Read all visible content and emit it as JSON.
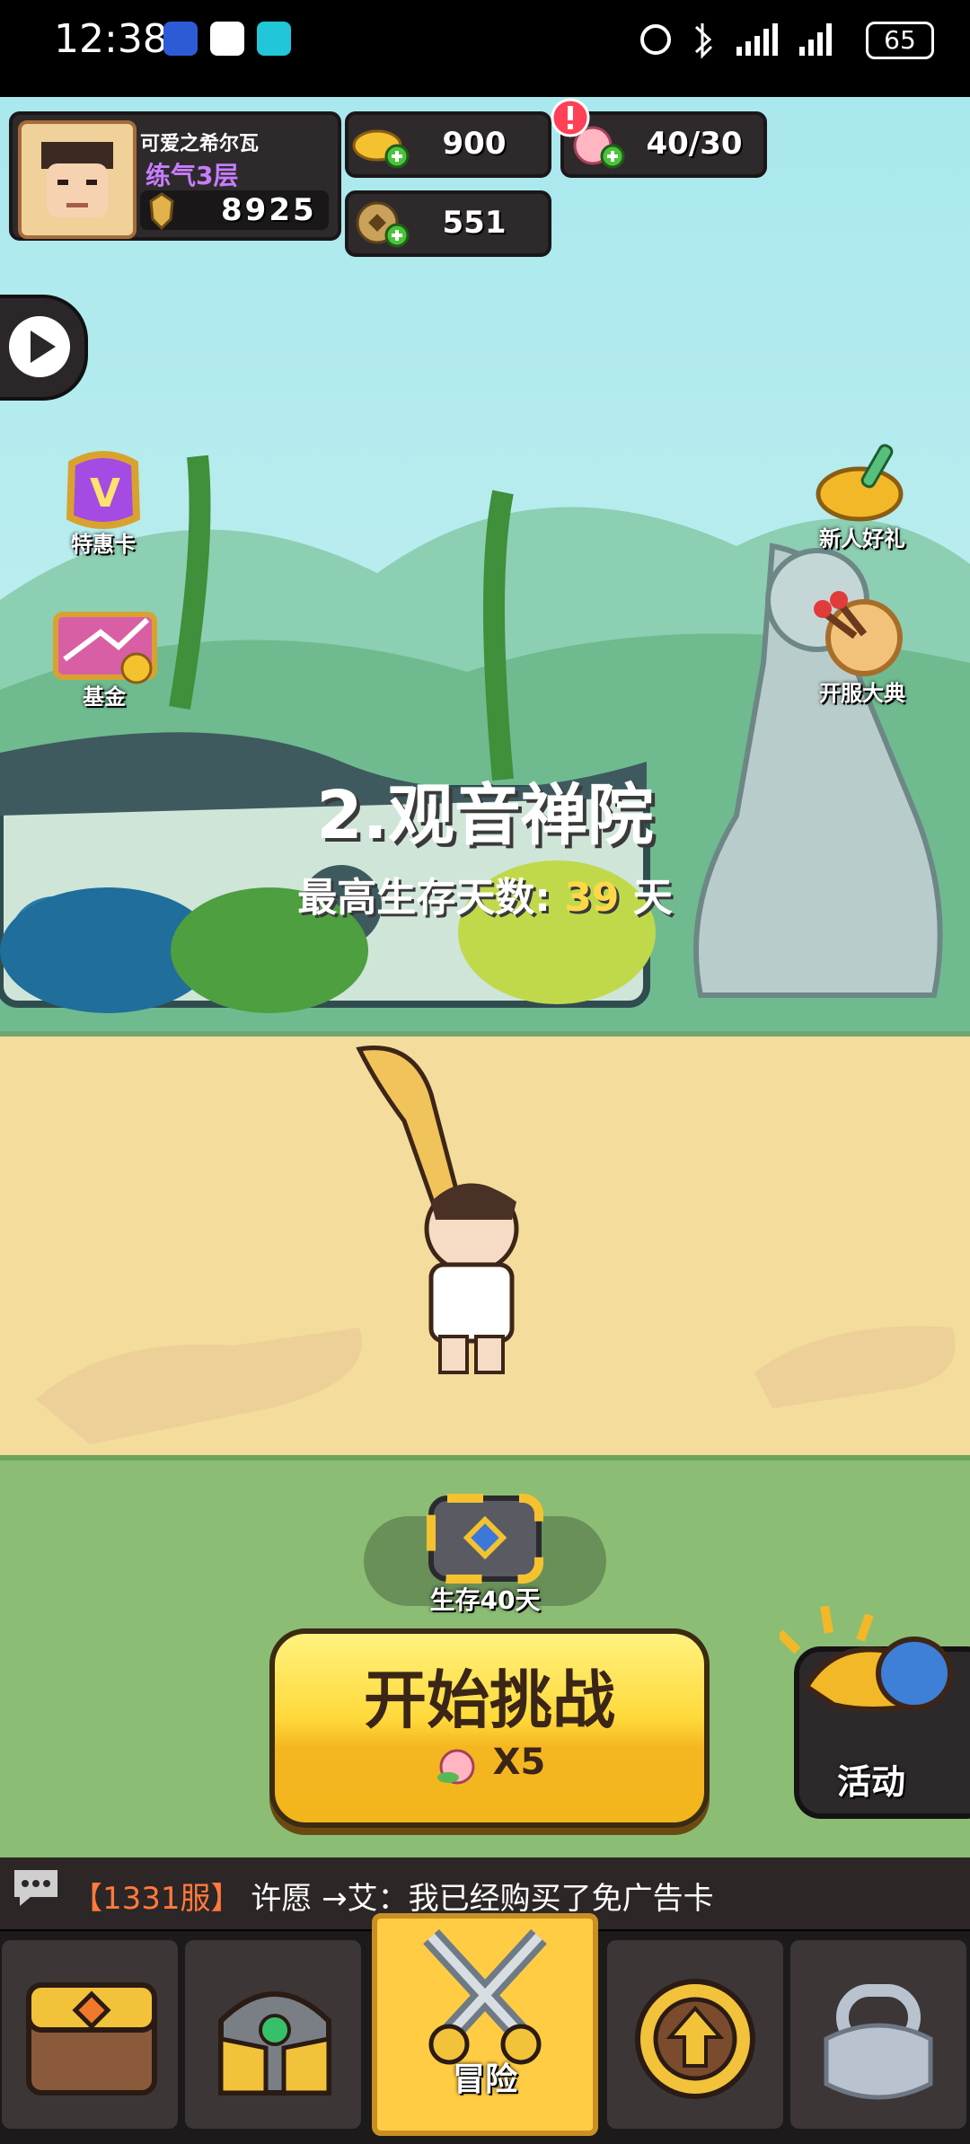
{
  "status_bar": {
    "time": "12:38",
    "battery": "65",
    "icons": [
      "alarm-icon",
      "bluetooth-icon",
      "signal-icon",
      "signal-icon"
    ]
  },
  "player": {
    "name": "可爱之希尔瓦",
    "realm": "练气3层",
    "power": "8925"
  },
  "resources": {
    "gold": "900",
    "stamina": "40/30",
    "coins": "551"
  },
  "side_left": {
    "special_card": "特惠卡",
    "fund": "基金"
  },
  "side_right": {
    "newbie_gift": "新人好礼",
    "server_event": "开服大典"
  },
  "stage": {
    "title": "2.观音禅院",
    "best_label": "最高生存天数:",
    "best_days": "39",
    "days_unit": "天"
  },
  "chest": {
    "label": "生存40天"
  },
  "start_button": {
    "label": "开始挑战",
    "cost": "X5"
  },
  "activity": {
    "label": "活动"
  },
  "chat": {
    "server": "【1331服】",
    "sender": "许愿",
    "message": "→艾：我已经购买了免广告卡"
  },
  "nav": {
    "adventure": "冒险"
  },
  "colors": {
    "realm_purple": "#c77dff",
    "best_days_yellow": "#ffd84a",
    "server_orange": "#ff7a3c",
    "start_yellow": "#ffd93b"
  }
}
